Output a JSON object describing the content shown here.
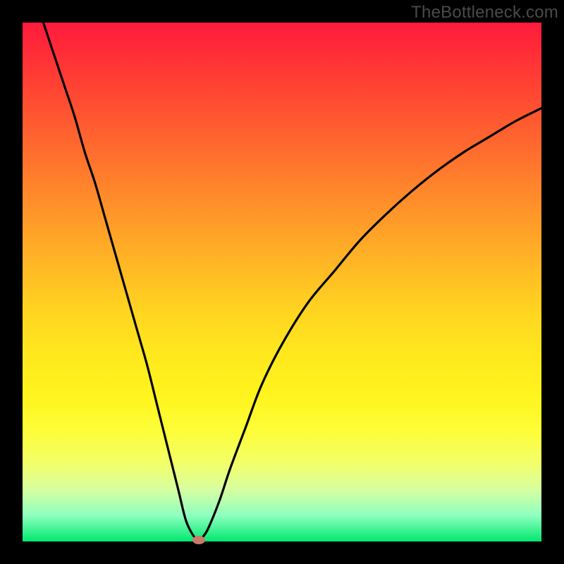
{
  "watermark": "TheBottleneck.com",
  "chart_data": {
    "type": "line",
    "title": "",
    "xlabel": "",
    "ylabel": "",
    "xlim": [
      0,
      100
    ],
    "ylim": [
      0,
      100
    ],
    "grid": false,
    "legend": false,
    "series": [
      {
        "name": "bottleneck-curve",
        "x": [
          4,
          6,
          8,
          10,
          12,
          14,
          16,
          18,
          20,
          22,
          24,
          26,
          28,
          30,
          31.5,
          33,
          34,
          35,
          36,
          38,
          40,
          43,
          46,
          50,
          55,
          60,
          65,
          70,
          75,
          80,
          85,
          90,
          95,
          100
        ],
        "y": [
          100,
          94,
          88,
          82,
          75,
          69,
          62,
          55,
          48,
          41,
          34,
          26,
          18,
          10,
          4,
          1,
          0.3,
          1.2,
          3,
          8,
          14,
          22,
          30,
          38,
          46,
          52,
          58,
          63,
          67.5,
          71.5,
          75,
          78,
          81,
          83.5
        ]
      }
    ],
    "marker": {
      "x": 34,
      "y": 0.3,
      "color": "#c97b6a"
    },
    "gradient": [
      {
        "stop": 0,
        "color": "#ff1a3c"
      },
      {
        "stop": 24,
        "color": "#ff6a2e"
      },
      {
        "stop": 55,
        "color": "#ffd321"
      },
      {
        "stop": 79,
        "color": "#fdfe3a"
      },
      {
        "stop": 100,
        "color": "#00e96f"
      }
    ]
  }
}
